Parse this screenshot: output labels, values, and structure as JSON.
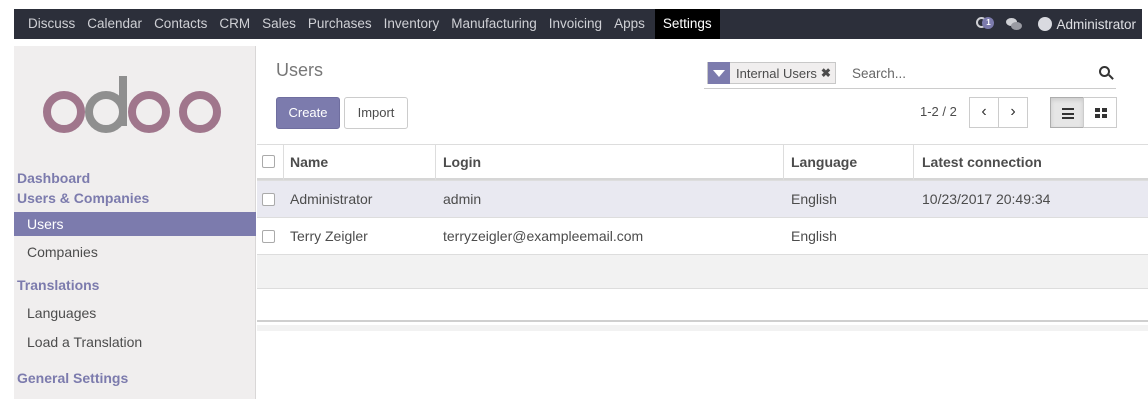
{
  "topnav": {
    "menu": [
      "Discuss",
      "Calendar",
      "Contacts",
      "CRM",
      "Sales",
      "Purchases",
      "Inventory",
      "Manufacturing",
      "Invoicing",
      "Apps"
    ],
    "active": "Settings",
    "notification_count": "1",
    "user": "Administrator"
  },
  "sidebar": {
    "logo_text": "odoo",
    "logo_color": "#a0768c",
    "sections": [
      {
        "label": "Dashboard",
        "items": []
      },
      {
        "label": "Users & Companies",
        "items": [
          "Users",
          "Companies"
        ]
      },
      {
        "label": "Translations",
        "items": [
          "Languages",
          "Load a Translation"
        ]
      },
      {
        "label": "General Settings",
        "items": []
      }
    ],
    "active_item": "Users"
  },
  "control": {
    "title": "Users",
    "create_label": "Create",
    "import_label": "Import",
    "facet_label": "Internal Users",
    "search_placeholder": "Search...",
    "pager": "1-2 / 2"
  },
  "table": {
    "columns": [
      "Name",
      "Login",
      "Language",
      "Latest connection"
    ],
    "rows": [
      {
        "name": "Administrator",
        "login": "admin",
        "language": "English",
        "latest": "10/23/2017 20:49:34"
      },
      {
        "name": "Terry Zeigler",
        "login": "terryzeigler@exampleemail.com",
        "language": "English",
        "latest": ""
      }
    ]
  },
  "colors": {
    "primary": "#7c7bad",
    "navbar": "#2c2f3a",
    "sidebar_bg": "#f0eeee"
  }
}
